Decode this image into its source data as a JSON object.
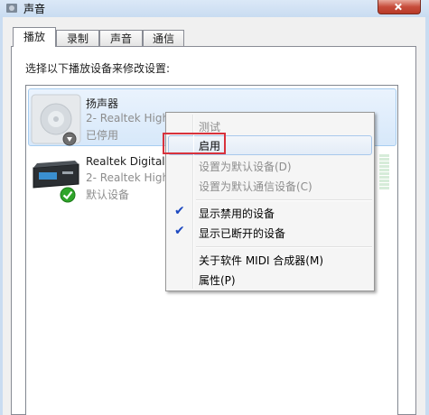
{
  "window": {
    "title": "声音",
    "icon": "speaker-icon"
  },
  "tabs": [
    {
      "label": "播放",
      "active": true
    },
    {
      "label": "录制",
      "active": false
    },
    {
      "label": "声音",
      "active": false
    },
    {
      "label": "通信",
      "active": false
    }
  ],
  "instruction": "选择以下播放设备来修改设置:",
  "devices": [
    {
      "name": "扬声器",
      "detail": "2- Realtek High",
      "status": "已停用",
      "icon": "speaker-disabled-icon",
      "selected": true
    },
    {
      "name": "Realtek Digital O",
      "detail": "2- Realtek High",
      "status": "默认设备",
      "icon": "digital-output-icon",
      "badge": "default-check-icon"
    }
  ],
  "context_menu": {
    "items": [
      {
        "label": "测试",
        "enabled": false,
        "checked": false
      },
      {
        "label": "启用",
        "enabled": true,
        "checked": false,
        "hovered": true,
        "highlighted": true
      },
      {
        "label": "设置为默认设备(D)",
        "enabled": false,
        "checked": false
      },
      {
        "label": "设置为默认通信设备(C)",
        "enabled": false,
        "checked": false
      },
      {
        "label": "显示禁用的设备",
        "enabled": true,
        "checked": true
      },
      {
        "label": "显示已断开的设备",
        "enabled": true,
        "checked": true
      },
      {
        "label": "关于软件 MIDI 合成器(M)",
        "enabled": true,
        "checked": false
      },
      {
        "label": "属性(P)",
        "enabled": true,
        "checked": false
      }
    ]
  },
  "colors": {
    "highlight_border": "#d8323c",
    "selection": "#d7e8fa",
    "check": "#1c48c0",
    "default_badge": "#2fa52a"
  }
}
